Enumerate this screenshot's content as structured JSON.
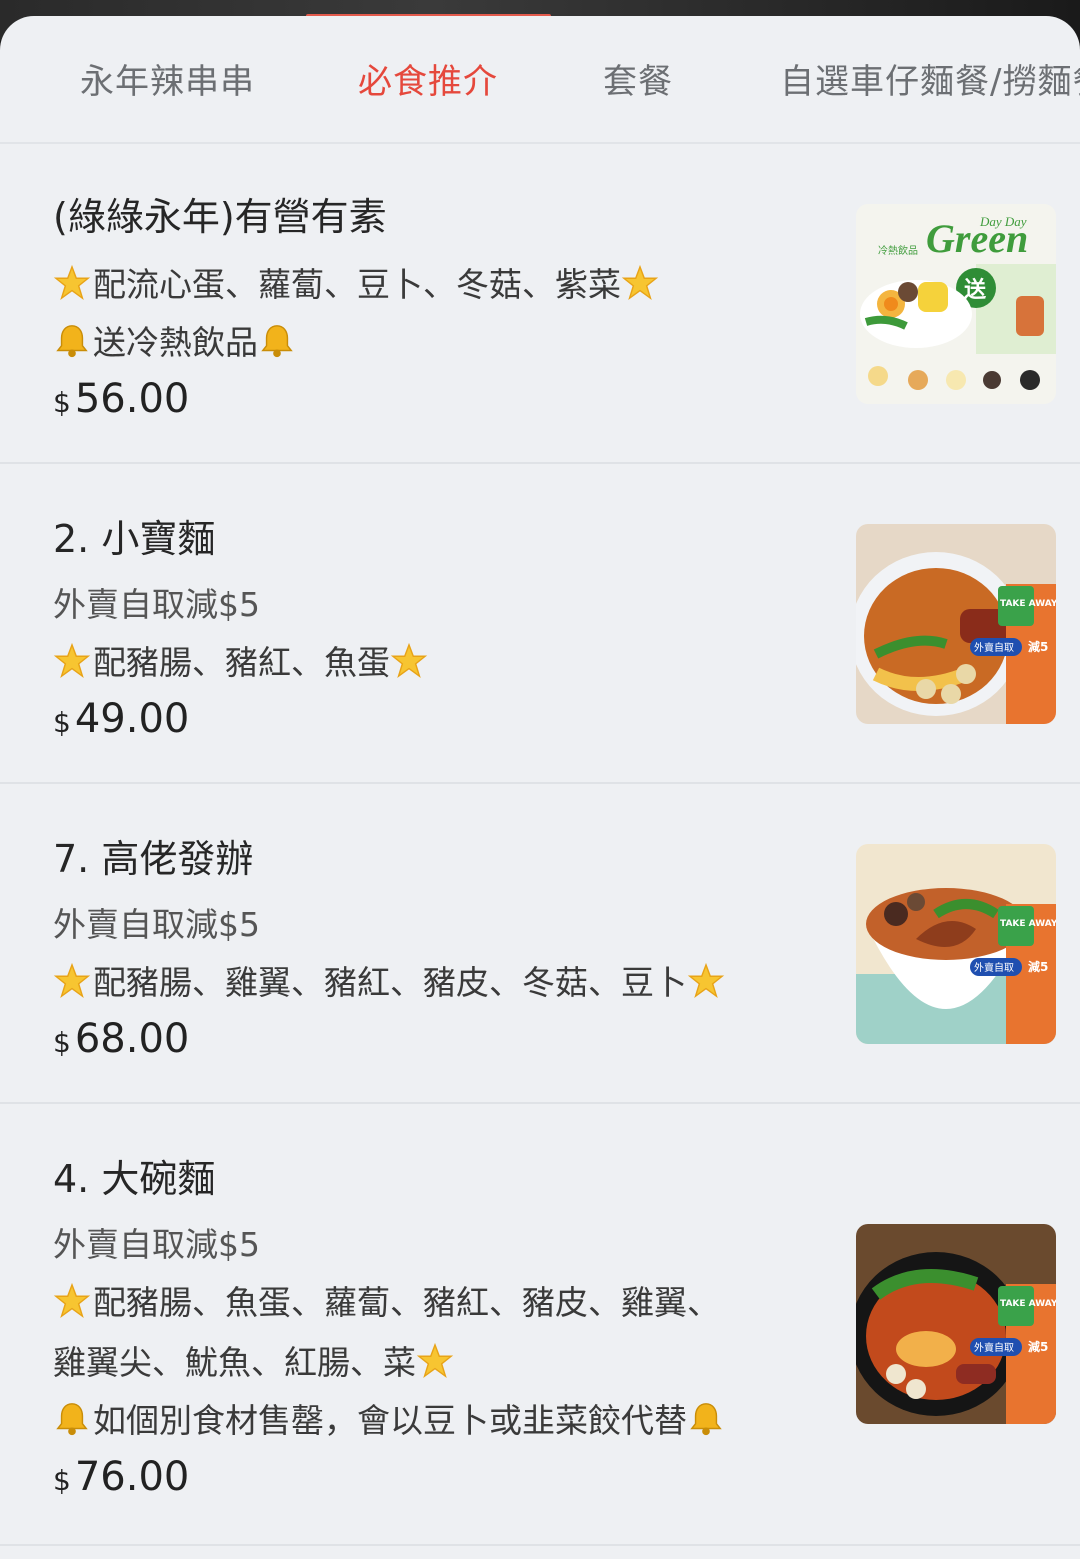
{
  "tabs": [
    {
      "label": "永年辣串串"
    },
    {
      "label": "必食推介"
    },
    {
      "label": "套餐"
    },
    {
      "label": "自選車仔麵餐/撈麵餐"
    }
  ],
  "active_tab": "必食推介",
  "colors": {
    "accent": "#e5483c",
    "background": "#eef0f3",
    "text": "#262626"
  },
  "items": [
    {
      "name": "(綠綠永年)有營有素",
      "line1": "配流心蛋、蘿蔔、豆卜、冬菇、紫菜",
      "line2": "送冷熱飲品",
      "currency": "$",
      "price": "56.00",
      "image": {
        "title": "Green",
        "subtitle": "Day Day",
        "badge": "送",
        "caption": "冷熱飲品"
      }
    },
    {
      "name": "2. 小寶麵",
      "subtitle": "外賣自取減$5",
      "line1": "配豬腸、豬紅、魚蛋",
      "currency": "$",
      "price": "49.00",
      "image": {
        "tag": "TAKE AWAY",
        "badge": "外賣自取",
        "discount": "減5"
      }
    },
    {
      "name": "7. 高佬發辦",
      "subtitle": "外賣自取減$5",
      "line1": "配豬腸、雞翼、豬紅、豬皮、冬菇、豆卜",
      "currency": "$",
      "price": "68.00",
      "image": {
        "tag": "TAKE AWAY",
        "badge": "外賣自取",
        "discount": "減5"
      }
    },
    {
      "name": "4. 大碗麵",
      "subtitle": "外賣自取減$5",
      "line1": "配豬腸、魚蛋、蘿蔔、豬紅、豬皮、雞翼、",
      "line2": "雞翼尖、魷魚、紅腸、菜",
      "line3": "如個別食材售罄，會以豆卜或韭菜餃代替",
      "currency": "$",
      "price": "76.00",
      "image": {
        "tag": "TAKE AWAY",
        "badge": "外賣自取",
        "discount": "減5"
      }
    }
  ]
}
